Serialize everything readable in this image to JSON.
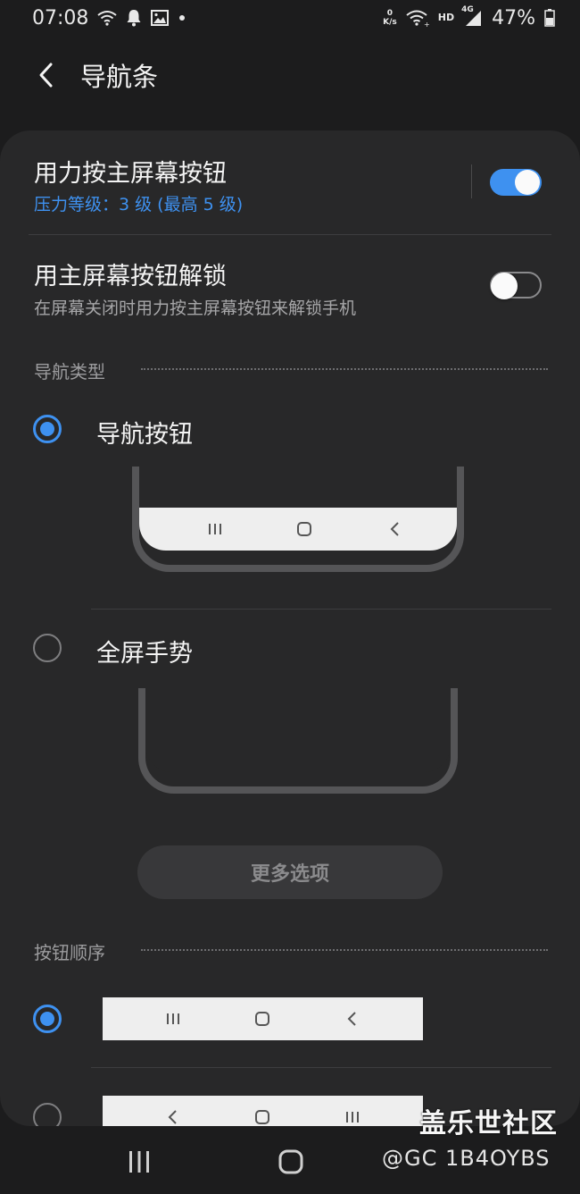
{
  "status_bar": {
    "time": "07:08",
    "net_speed_top": "0",
    "net_speed_bottom": "K/s",
    "hd_label": "HD",
    "network_label": "4G",
    "battery": "47%"
  },
  "header": {
    "title": "导航条"
  },
  "settings": {
    "force_press": {
      "title": "用力按主屏幕按钮",
      "subtitle": "压力等级：3 级 (最高 5 级)",
      "enabled": true
    },
    "unlock": {
      "title": "用主屏幕按钮解锁",
      "subtitle": "在屏幕关闭时用力按主屏幕按钮来解锁手机",
      "enabled": false
    }
  },
  "nav_type": {
    "header": "导航类型",
    "options": [
      {
        "label": "导航按钮",
        "selected": true
      },
      {
        "label": "全屏手势",
        "selected": false
      }
    ],
    "more_button": "更多选项"
  },
  "button_order": {
    "header": "按钮顺序",
    "options": [
      {
        "order": [
          "recents",
          "home",
          "back"
        ],
        "selected": true
      },
      {
        "order": [
          "back",
          "home",
          "recents"
        ],
        "selected": false
      }
    ]
  },
  "watermark": {
    "main": "盖乐世社区",
    "sub": "@GC 1B4OYBS"
  },
  "colors": {
    "accent": "#3e91f0",
    "background": "#1c1c1d",
    "card": "#282829"
  }
}
